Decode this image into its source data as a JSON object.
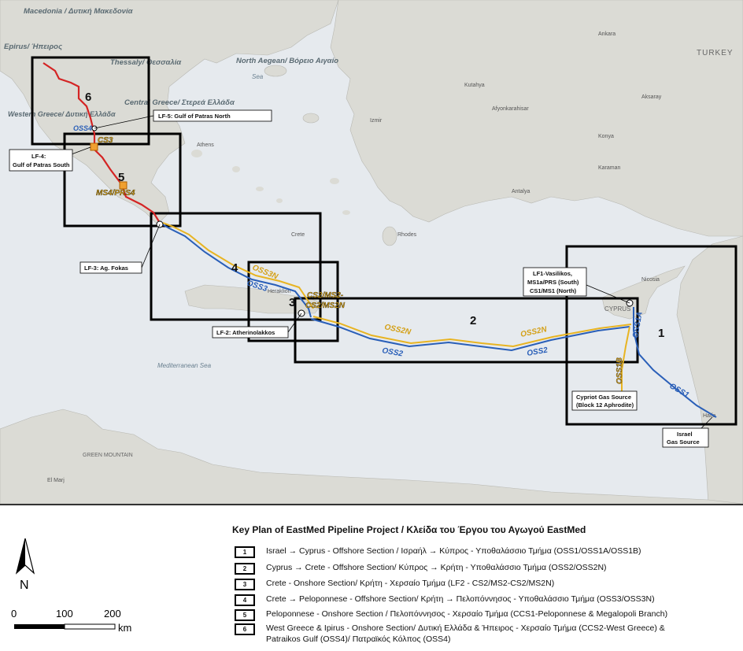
{
  "map": {
    "regions": {
      "macedonia": "Macedonia / Δυτική Μακεδονία",
      "epirus": "Epirus/ Ήπειρος",
      "thessaly": "Thessaly/ Θεσσαλία",
      "north_aegean": "North Aegean/ Βόρειο Αιγαίο",
      "central_greece": "Central Greece/ Στερεά Ελλάδα",
      "western_greece": "Western Greece/ Δυτική Ελλάδα",
      "turkey": "TURKEY",
      "cyprus": "CYPRUS",
      "mediterranean": "Mediterranean Sea",
      "green_mountain": "GREEN MOUNTAIN",
      "aegean_sea": "Sea"
    },
    "cities": [
      "Izmir",
      "Ankara",
      "Kutahya",
      "Afyonkarahisar",
      "Konya",
      "Karaman",
      "Antalya",
      "Aksaray",
      "Athens",
      "Nicosia",
      "Haifa",
      "Rhodes",
      "Crete",
      "Heraklion",
      "El Marj"
    ],
    "labels": {
      "oss4": "OSS4",
      "oss3": "OSS3",
      "oss3n": "OSS3N",
      "oss2": "OSS2",
      "oss2n": "OSS2N",
      "oss1": "OSS1",
      "oss1a": "OSS1A",
      "oss1b": "OSS1B",
      "cs3": "CS3",
      "ms4prs4": "MS4/PRS4",
      "cs2ms2": "CS2/MS2-",
      "cs2ms2n": "CS2/MS2N"
    },
    "sections": [
      "1",
      "2",
      "3",
      "4",
      "5",
      "6"
    ],
    "callouts": {
      "lf5": "LF-5: Gulf of Patras North",
      "lf4_a": "LF-4:",
      "lf4_b": "Gulf of Patras South",
      "lf3": "LF-3: Ag. Fokas",
      "lf2": "LF-2: Atherinolakkos",
      "lf1_a": "LF1-Vasilikos,",
      "lf1_b": "MS1a/PRS (South)",
      "lf1_c": "CS1/MS1 (North)",
      "cypriot_a": "Cypriot Gas Source",
      "cypriot_b": "(Block 12 Aphrodite)",
      "israel_a": "Israel",
      "israel_b": "Gas Source"
    },
    "colors": {
      "sea": "#e7ebef",
      "land": "#dcdcd6",
      "offshore": "#2a5fb8",
      "onshore": "#d42424",
      "n_branch": "#e8b422",
      "box": "#000000"
    }
  },
  "legend": {
    "title": "Key Plan of EastMed Pipeline Project / Κλείδα του Έργου του Αγωγού EastMed",
    "items": [
      {
        "num": "1",
        "text": "Israel → Cyprus - Offshore Section / Ισραήλ → Κύπρος - Υποθαλάσσιο Τμήμα (OSS1/OSS1A/OSS1B)"
      },
      {
        "num": "2",
        "text": "Cyprus → Crete - Offshore Section/ Κύπρος → Κρήτη - Υποθαλάσσιο Τμήμα (OSS2/OSS2N)"
      },
      {
        "num": "3",
        "text": "Crete - Onshore Section/ Κρήτη - Χερσαίο Τμήμα (LF2 - CS2/MS2-CS2/MS2N)"
      },
      {
        "num": "4",
        "text": "Crete → Peloponnese - Offshore Section/ Κρήτη → Πελοπόννησος - Υποθαλάσσιο Τμήμα  (OSS3/OSS3N)"
      },
      {
        "num": "5",
        "text": "Peloponnese - Onshore Section / Πελοπόννησος - Χερσαίο Τμήμα (CCS1-Peloponnese & Megalopoli Branch)"
      },
      {
        "num": "6",
        "text": "West Greece & Ipirus - Onshore Section/ Δυτική Ελλάδα & Ήπειρος - Χερσαίο Τμήμα (CCS2-West Greece) &"
      },
      {
        "num": "",
        "text": "Patraikos Gulf (OSS4)/ Πατραϊκός Κόλπος  (OSS4)"
      }
    ]
  },
  "north_arrow": "N",
  "scale": {
    "ticks": [
      "0",
      "100",
      "200"
    ],
    "unit": "km"
  }
}
